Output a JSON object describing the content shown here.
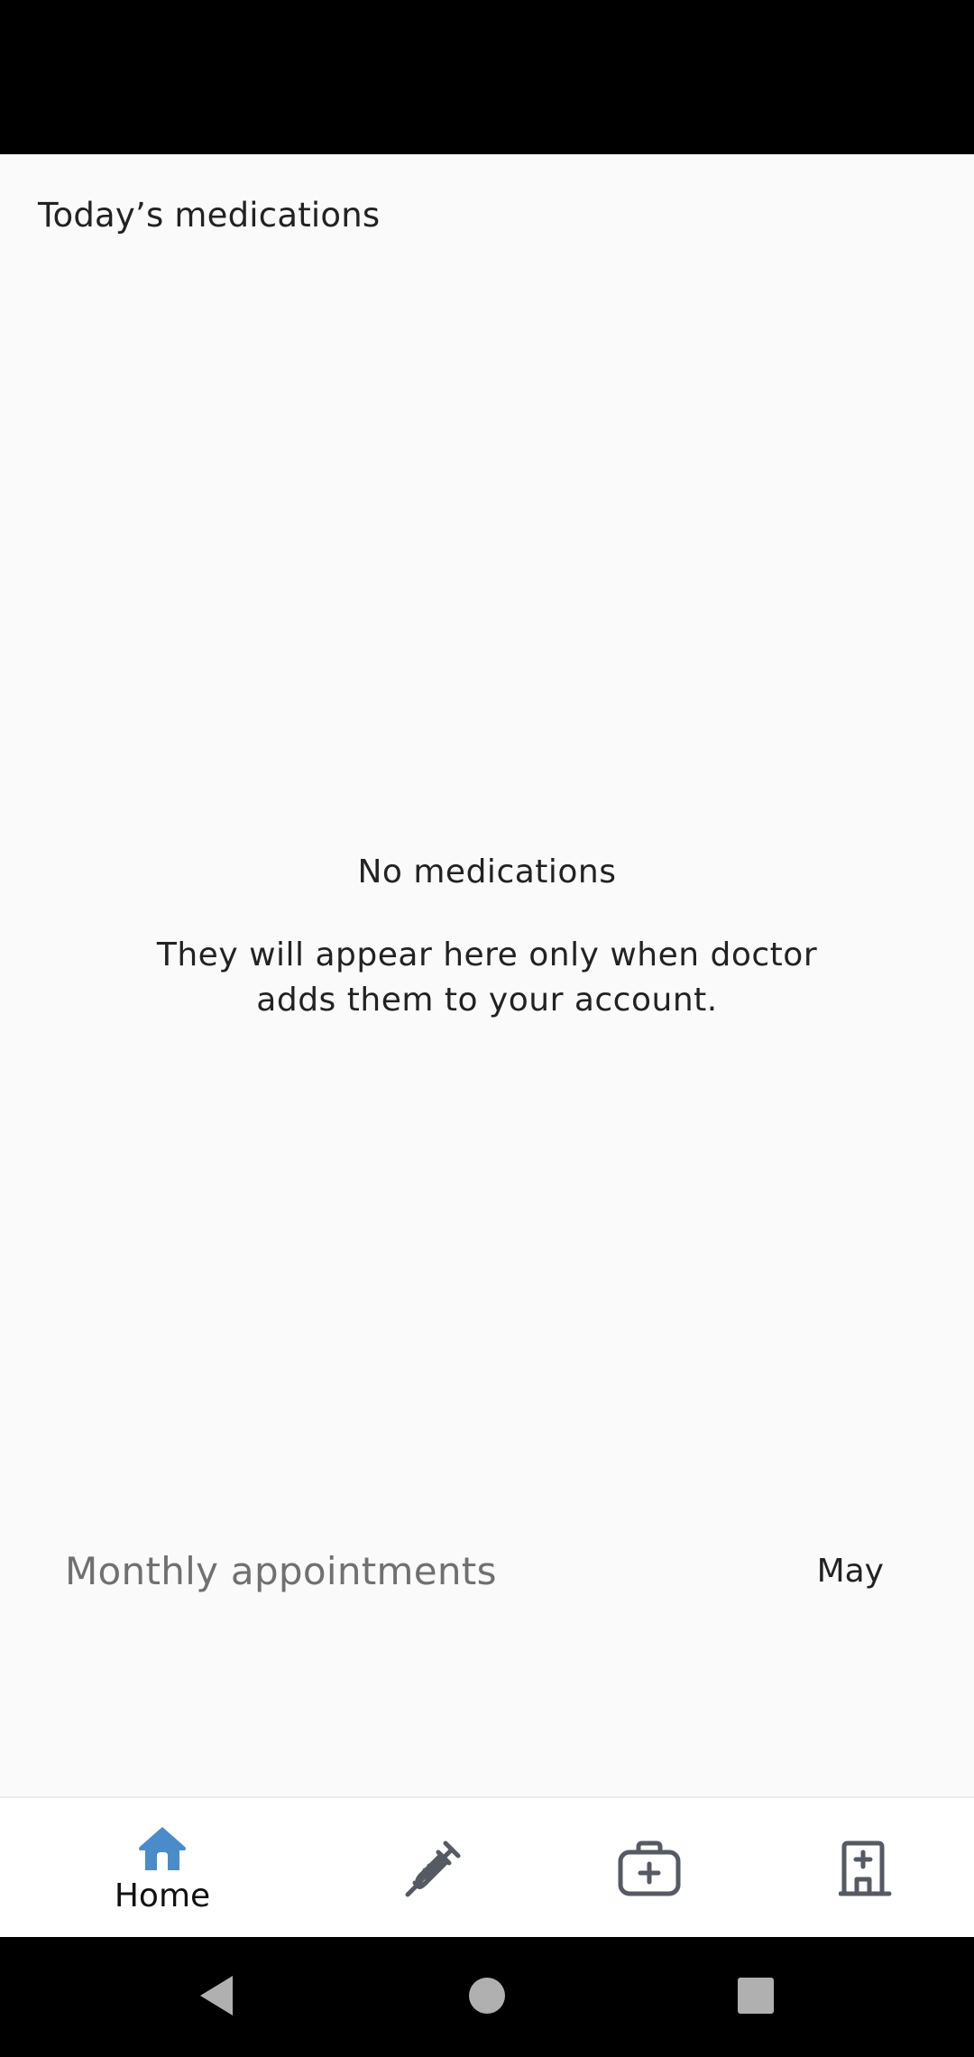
{
  "medications": {
    "section_title": "Today’s medications",
    "empty_title": "No medications",
    "empty_description": "They will appear here only when doctor adds them to your account."
  },
  "appointments": {
    "title": "Monthly appointments",
    "month": "May"
  },
  "bottom_nav": {
    "items": [
      {
        "icon": "home-icon",
        "label": "Home",
        "active": true
      },
      {
        "icon": "syringe-icon",
        "label": "",
        "active": false
      },
      {
        "icon": "medical-kit-icon",
        "label": "",
        "active": false
      },
      {
        "icon": "hospital-icon",
        "label": "",
        "active": false
      }
    ],
    "active_color": "#4A8CC9",
    "inactive_color": "#555A63"
  },
  "system_nav": {
    "buttons": [
      "back-icon",
      "home-circle-icon",
      "recents-icon"
    ]
  }
}
